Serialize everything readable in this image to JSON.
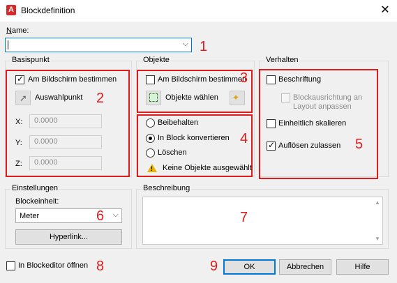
{
  "window": {
    "title": "Blockdefinition",
    "app_icon": "autocad-icon",
    "close_glyph": "✕"
  },
  "name": {
    "label": "Name:",
    "value": ""
  },
  "basispunkt": {
    "title": "Basispunkt",
    "on_screen_label": "Am Bildschirm bestimmen",
    "on_screen_checked": true,
    "pick_point_label": "Auswahlpunkt",
    "x_label": "X:",
    "x_value": "0.0000",
    "y_label": "Y:",
    "y_value": "0.0000",
    "z_label": "Z:",
    "z_value": "0.0000"
  },
  "objekte": {
    "title": "Objekte",
    "on_screen_label": "Am Bildschirm bestimmen",
    "on_screen_checked": false,
    "select_objects_label": "Objekte wählen",
    "options": [
      {
        "label": "Beibehalten",
        "checked": false
      },
      {
        "label": "In Block konvertieren",
        "checked": true
      },
      {
        "label": "Löschen",
        "checked": false
      }
    ],
    "warning": "Keine Objekte ausgewählt"
  },
  "verhalten": {
    "title": "Verhalten",
    "annotative_label": "Beschriftung",
    "annotative_checked": false,
    "match_orientation_label": "Blockausrichtung an Layout anpassen",
    "scale_uniformly_label": "Einheitlich skalieren",
    "scale_uniformly_checked": false,
    "allow_exploding_label": "Auflösen zulassen",
    "allow_exploding_checked": true
  },
  "einstellungen": {
    "title": "Einstellungen",
    "unit_label": "Blockeinheit:",
    "unit_value": "Meter",
    "hyperlink_label": "Hyperlink..."
  },
  "beschreibung": {
    "title": "Beschreibung",
    "value": ""
  },
  "footer": {
    "open_in_editor_label": "In Blockeditor öffnen",
    "open_in_editor_checked": false,
    "ok_label": "OK",
    "cancel_label": "Abbrechen",
    "help_label": "Hilfe"
  },
  "annotations": {
    "color": "#e01b1b",
    "numbers": [
      "1",
      "2",
      "3",
      "4",
      "5",
      "6",
      "7",
      "8",
      "9"
    ]
  }
}
